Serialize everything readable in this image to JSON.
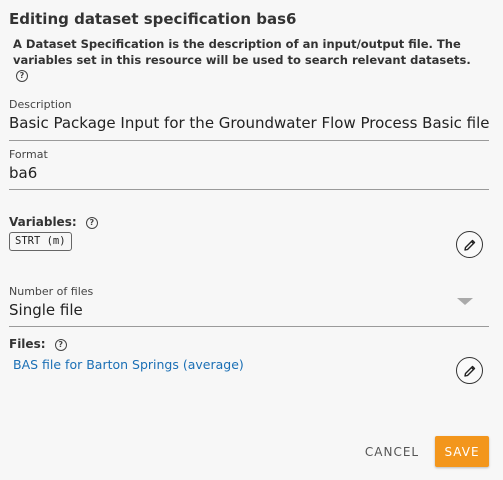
{
  "dialog": {
    "title": "Editing dataset specification bas6",
    "intro": "A Dataset Specification is the description of an input/output file. The variables set in this resource will be used to search relevant datasets."
  },
  "description": {
    "label": "Description",
    "value": "Basic Package Input for the Groundwater Flow Process Basic file"
  },
  "format": {
    "label": "Format",
    "value": "ba6"
  },
  "variables": {
    "label": "Variables:",
    "items": [
      "STRT (m)"
    ]
  },
  "number_of_files": {
    "label": "Number of files",
    "value": "Single file"
  },
  "files": {
    "label": "Files:",
    "items": [
      "BAS file for Barton Springs (average)"
    ]
  },
  "actions": {
    "cancel": "CANCEL",
    "save": "SAVE"
  },
  "colors": {
    "accent": "#f3961c",
    "link": "#1a6fb5"
  },
  "icons": {
    "help": "help-circle-icon",
    "edit": "pencil-icon",
    "dropdown": "caret-down-icon"
  }
}
